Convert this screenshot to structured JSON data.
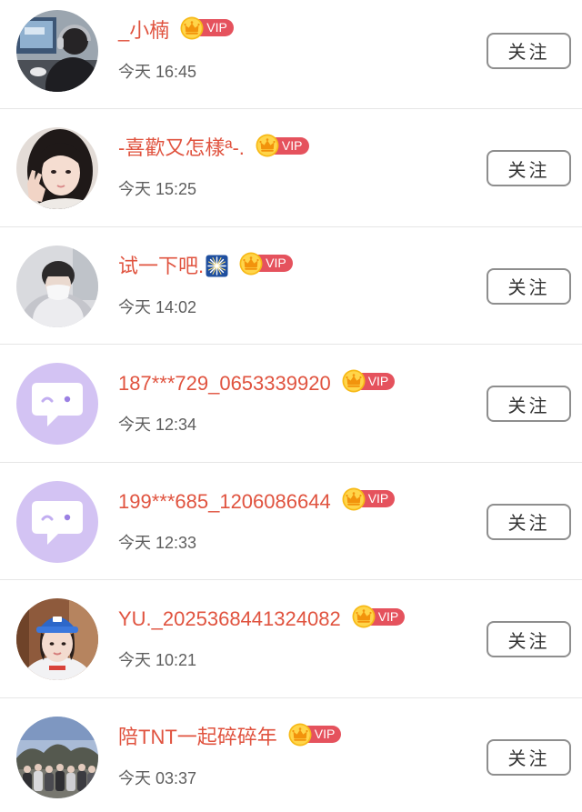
{
  "users": [
    {
      "name": "_小楠",
      "vip_label": "VIP",
      "time": "今天 16:45",
      "follow_label": "关注",
      "avatar": "user-photo"
    },
    {
      "name": "-喜歡又怎樣ª-.",
      "vip_label": "VIP",
      "time": "今天 15:25",
      "follow_label": "关注",
      "avatar": "user-photo"
    },
    {
      "name": "试一下吧.",
      "name_emoji": "fireworks-emoji-icon",
      "vip_label": "VIP",
      "time": "今天 14:02",
      "follow_label": "关注",
      "avatar": "user-photo"
    },
    {
      "name": "187***729_0653339920",
      "vip_label": "VIP",
      "time": "今天 12:34",
      "follow_label": "关注",
      "avatar": "default-avatar-icon"
    },
    {
      "name": "199***685_1206086644",
      "vip_label": "VIP",
      "time": "今天 12:33",
      "follow_label": "关注",
      "avatar": "default-avatar-icon"
    },
    {
      "name": "YU._2025368441324082",
      "vip_label": "VIP",
      "time": "今天 10:21",
      "follow_label": "关注",
      "avatar": "user-photo"
    },
    {
      "name": "陪TNT一起碎碎年",
      "vip_label": "VIP",
      "time": "今天 03:37",
      "follow_label": "关注",
      "avatar": "user-photo"
    }
  ],
  "badge_icon": "crown-icon",
  "colors": {
    "name_text": "#e0533f",
    "vip_pill": "#e5525d",
    "vip_crown": "#ffcf33",
    "time_text": "#5e5e5e",
    "divider": "#e6e6e6",
    "button_border": "#8e8e8e",
    "button_text": "#333333",
    "default_avatar_bg": "#d3c3f3"
  }
}
